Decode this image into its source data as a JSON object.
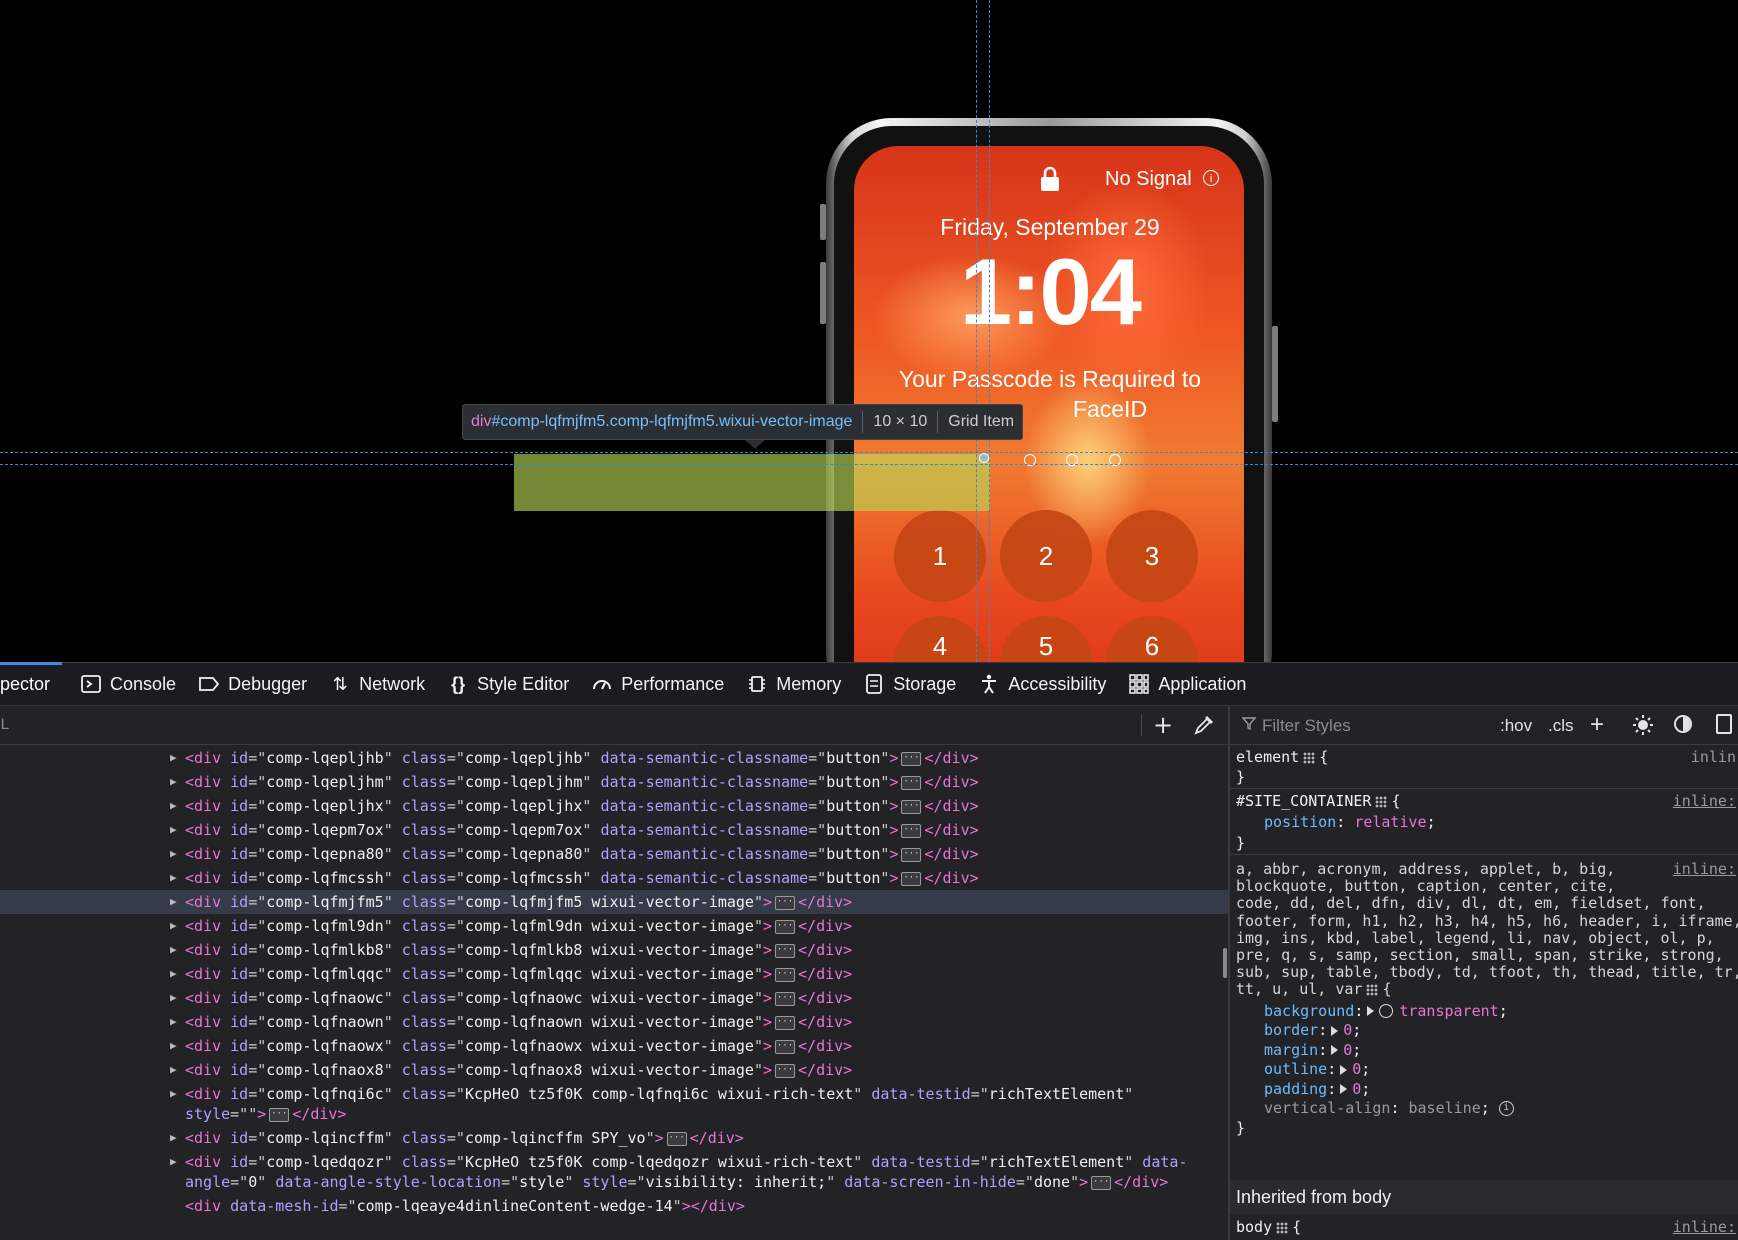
{
  "phone": {
    "status": "No Signal",
    "date": "Friday, September 29",
    "time": "1:04",
    "passcode_line1": "Your Passcode is Required to",
    "passcode_line2": "FaceID",
    "keys": [
      "1",
      "2",
      "3",
      "4",
      "5",
      "6"
    ]
  },
  "infobar": {
    "tag": "div",
    "selector": "#comp-lqfmjfm5.comp-lqfmjfm5.wixui-vector-image",
    "size": "10 × 10",
    "kind": "Grid Item"
  },
  "toolbar": {
    "tabs": [
      {
        "label": "pector",
        "icon": "inspector-icon",
        "active": true
      },
      {
        "label": "Console",
        "icon": "console-icon"
      },
      {
        "label": "Debugger",
        "icon": "debugger-icon"
      },
      {
        "label": "Network",
        "icon": "network-icon"
      },
      {
        "label": "Style Editor",
        "icon": "style-editor-icon"
      },
      {
        "label": "Performance",
        "icon": "performance-icon"
      },
      {
        "label": "Memory",
        "icon": "memory-icon"
      },
      {
        "label": "Storage",
        "icon": "storage-icon"
      },
      {
        "label": "Accessibility",
        "icon": "accessibility-icon"
      },
      {
        "label": "Application",
        "icon": "application-icon"
      }
    ]
  },
  "markup": {
    "search_text": "L",
    "rows": [
      {
        "id": "comp-lqepljhb",
        "class": "comp-lqepljhb",
        "sem": "button"
      },
      {
        "id": "comp-lqepljhm",
        "class": "comp-lqepljhm",
        "sem": "button"
      },
      {
        "id": "comp-lqepljhx",
        "class": "comp-lqepljhx",
        "sem": "button"
      },
      {
        "id": "comp-lqepm7ox",
        "class": "comp-lqepm7ox",
        "sem": "button"
      },
      {
        "id": "comp-lqepna80",
        "class": "comp-lqepna80",
        "sem": "button"
      },
      {
        "id": "comp-lqfmcssh",
        "class": "comp-lqfmcssh",
        "sem": "button"
      },
      {
        "id": "comp-lqfmjfm5",
        "class": "comp-lqfmjfm5 wixui-vector-image",
        "selected": true
      },
      {
        "id": "comp-lqfml9dn",
        "class": "comp-lqfml9dn wixui-vector-image"
      },
      {
        "id": "comp-lqfmlkb8",
        "class": "comp-lqfmlkb8 wixui-vector-image"
      },
      {
        "id": "comp-lqfmlqqc",
        "class": "comp-lqfmlqqc wixui-vector-image"
      },
      {
        "id": "comp-lqfnaowc",
        "class": "comp-lqfnaowc wixui-vector-image"
      },
      {
        "id": "comp-lqfnaown",
        "class": "comp-lqfnaown wixui-vector-image"
      },
      {
        "id": "comp-lqfnaowx",
        "class": "comp-lqfnaowx wixui-vector-image"
      },
      {
        "id": "comp-lqfnaox8",
        "class": "comp-lqfnaox8 wixui-vector-image"
      }
    ],
    "rich1": {
      "id": "comp-lqfnqi6c",
      "class": "KcpHeO tz5f0K comp-lqfnqi6c wixui-rich-text",
      "testid": "richTextElement",
      "style": ""
    },
    "row_incffm": {
      "id": "comp-lqincffm",
      "class": "comp-lqincffm SPY_vo"
    },
    "rich2": {
      "id": "comp-lqedqozr",
      "class": "KcpHeO tz5f0K comp-lqedqozr wixui-rich-text",
      "testid": "richTextElement",
      "angle": "0",
      "angle_loc": "style",
      "style": "visibility: inherit;",
      "hide": "done"
    },
    "mesh": "comp-lqeaye4dinlineContent-wedge-14"
  },
  "rules": {
    "filter_placeholder": "Filter Styles",
    "hov": ":hov",
    "cls": ".cls",
    "element_selector": "element",
    "element_src": "inlin",
    "site_selector": "#SITE_CONTAINER",
    "site_src": "inline:",
    "site_prop": "position",
    "site_val": "relative",
    "reset_src": "inline:",
    "reset_lines": [
      "a, abbr, acronym, address, applet, b, big,",
      "blockquote, button, caption, center, cite,",
      "code, dd, del, dfn, div, dl, dt, em, fieldset, font,",
      "footer, form, h1, h2, h3, h4, h5, h6, header, i, iframe,",
      "img, ins, kbd, label, legend, li, nav, object, ol, p,",
      "pre, q, s, samp, section, small, span, strike, strong,",
      "sub, sup, table, tbody, td, tfoot, th, thead, title, tr,",
      "tt, u, ul, var"
    ],
    "reset_props": [
      {
        "name": "background",
        "value": "transparent",
        "swatch": true
      },
      {
        "name": "border",
        "value": "0",
        "expand": true
      },
      {
        "name": "margin",
        "value": "0",
        "expand": true
      },
      {
        "name": "outline",
        "value": "0",
        "expand": true
      },
      {
        "name": "padding",
        "value": "0",
        "expand": true
      },
      {
        "name": "vertical-align",
        "value": "baseline",
        "plain": true
      }
    ],
    "inherited_label": "Inherited from body",
    "body_selector": "body",
    "body_src": "inline:"
  }
}
